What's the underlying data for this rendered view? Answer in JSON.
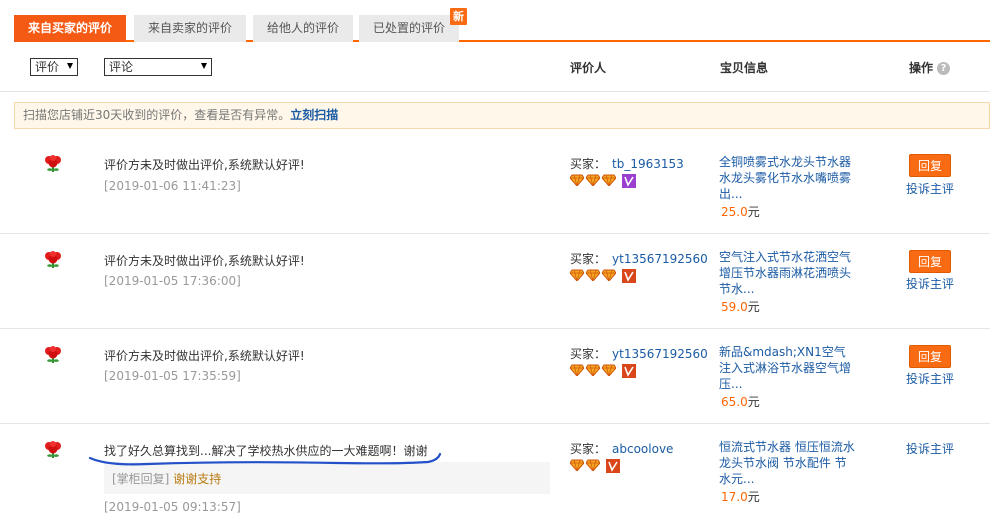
{
  "tabs": [
    {
      "label": "来自买家的评价",
      "active": true
    },
    {
      "label": "来自卖家的评价",
      "active": false
    },
    {
      "label": "给他人的评价",
      "active": false
    },
    {
      "label": "已处置的评价",
      "active": false
    }
  ],
  "new_badge": "新",
  "filters": {
    "rating": "评价",
    "comment": "评论"
  },
  "columns": {
    "reviewer": "评价人",
    "item": "宝贝信息",
    "action": "操作",
    "help": "?"
  },
  "notice": {
    "text": "扫描您店铺近30天收到的评价，查看是否有异常。",
    "link": "立刻扫描"
  },
  "rows": [
    {
      "comment": "评价方未及时做出评价,系统默认好评!",
      "date": "[2019-01-06 11:41:23]",
      "buyer_label": "买家：",
      "buyer": "tb_1963153",
      "item": "全铜喷雾式水龙头节水器 水龙头雾化节水水嘴喷雾出...",
      "price": "25.0",
      "currency": "元",
      "reply": "回复",
      "complain": "投诉主评"
    },
    {
      "comment": "评价方未及时做出评价,系统默认好评!",
      "date": "[2019-01-05 17:36:00]",
      "buyer_label": "买家：",
      "buyer": "yt13567192560",
      "item": "空气注入式节水花洒空气增压节水器雨淋花洒喷头节水...",
      "price": "59.0",
      "currency": "元",
      "reply": "回复",
      "complain": "投诉主评"
    },
    {
      "comment": "评价方未及时做出评价,系统默认好评!",
      "date": "[2019-01-05 17:35:59]",
      "buyer_label": "买家：",
      "buyer": "yt13567192560",
      "item": "新品&mdash;XN1空气注入式淋浴节水器空气增压...",
      "price": "65.0",
      "currency": "元",
      "reply": "回复",
      "complain": "投诉主评"
    },
    {
      "comment": "找了好久总算找到...解决了学校热水供应的一大难题啊！谢谢",
      "date": "[2019-01-05 09:13:57]",
      "buyer_label": "买家：",
      "buyer": "abcoolove",
      "item": "恒流式节水器 恒压恒流水龙头节水阀 节水配件 节水元...",
      "price": "17.0",
      "currency": "元",
      "reply_label": "[掌柜回复]",
      "reply_text": "谢谢支持",
      "complain": "投诉主评"
    }
  ],
  "colors": {
    "accent": "#f55a14",
    "link": "#1b5ba4",
    "price": "#ff6600"
  },
  "icons": [
    "flower-icon",
    "diamond-icon",
    "vip-icon",
    "caret-down-icon"
  ]
}
